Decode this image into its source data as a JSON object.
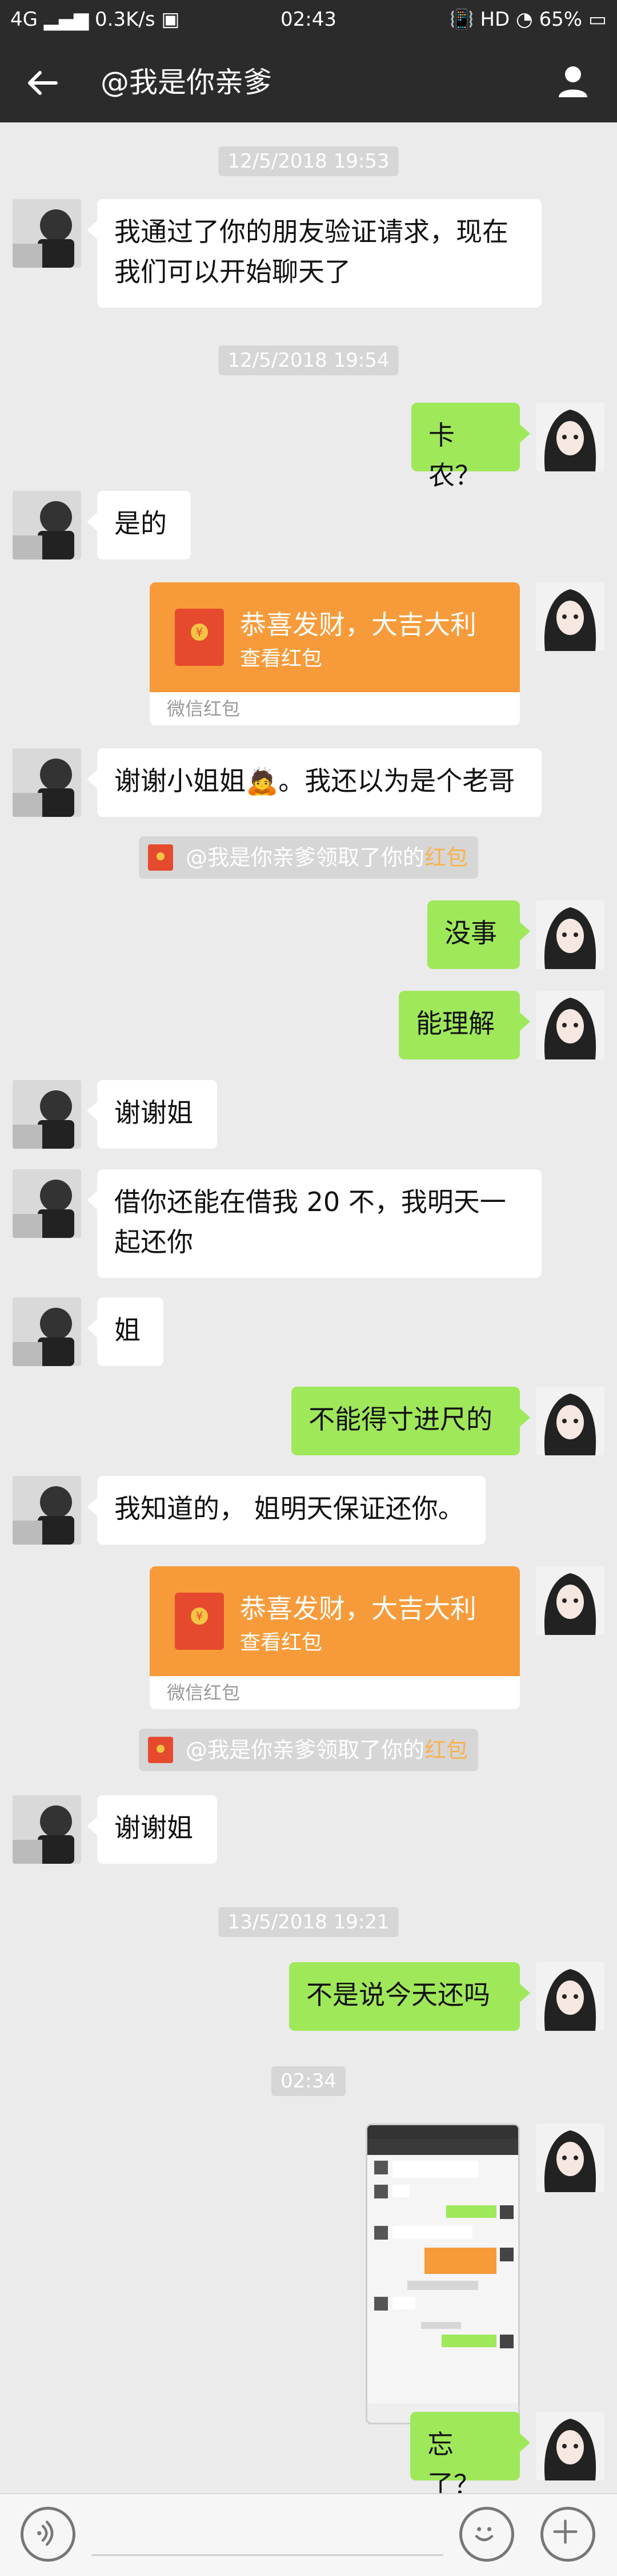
{
  "status_bar": {
    "network": "4G",
    "speed": "0.3K/s",
    "time": "02:43",
    "hd": "HD",
    "battery": "65%"
  },
  "nav": {
    "title": "@我是你亲爹"
  },
  "chat": {
    "t1": "12/5/2018 19:53",
    "m1": "我通过了你的朋友验证请求，现在我们可以开始聊天了",
    "t2": "12/5/2018 19:54",
    "m2": "卡农？",
    "m3": "是的",
    "redpacket1": {
      "title": "恭喜发财，大吉大利",
      "sub": "查看红包",
      "footer": "微信红包"
    },
    "m4": "谢谢小姐姐🙇。我还以为是个老哥",
    "notice1": {
      "text": "@我是你亲爹领取了你的",
      "link": "红包"
    },
    "m5": "没事",
    "m6": "能理解",
    "m7": "谢谢姐",
    "m8": "借你还能在借我 20 不，我明天一起还你",
    "m9": "姐",
    "m10": "不能得寸进尺的",
    "m11": "我知道的， 姐明天保证还你。",
    "redpacket2": {
      "title": "恭喜发财，大吉大利",
      "sub": "查看红包",
      "footer": "微信红包"
    },
    "notice2": {
      "text": "@我是你亲爹领取了你的",
      "link": "红包"
    },
    "m12": "谢谢姐",
    "t3": "13/5/2018 19:21",
    "m13": "不是说今天还吗",
    "t4": "02:34",
    "m14": "忘了？"
  },
  "colors": {
    "background": "#ebebeb",
    "nav": "#2b2b2b",
    "outgoing_bubble": "#9fe85a",
    "incoming_bubble": "#ffffff",
    "red_packet": "#f79b3a"
  },
  "icons": {
    "back": "back-arrow-icon",
    "profile": "profile-icon",
    "voice": "voice-input-icon",
    "emoji": "emoji-icon",
    "plus": "plus-icon"
  }
}
